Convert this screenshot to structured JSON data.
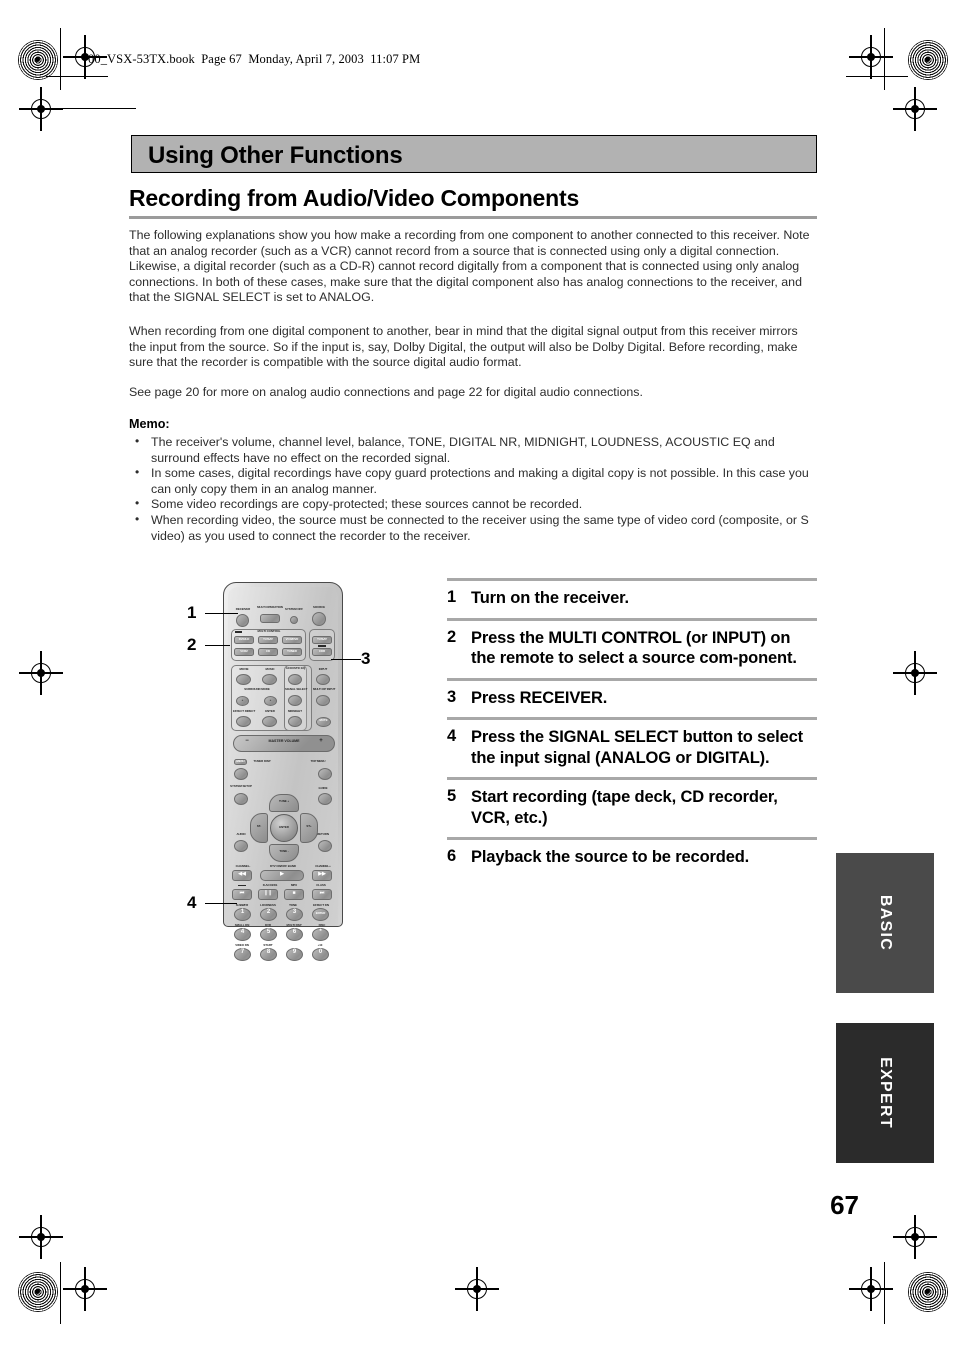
{
  "doc_header": "00_VSX-53TX.book  Page 67  Monday, April 7, 2003  11:07 PM",
  "section_bar_title": "Using Other Functions",
  "heading": "Recording from Audio/Video Components",
  "paragraphs": [
    "The following explanations show you how make a recording from one component to another connected to this receiver. Note that an analog recorder (such as a VCR) cannot record from a source that is connected using only a digital connection. Likewise, a digital recorder (such as a CD-R) cannot record digitally from a component that is connected using only analog connections. In both of these cases, make sure that the digital component also has analog connections to the receiver, and that the SIGNAL SELECT is set to ANALOG.",
    "When recording from one digital component to another, bear in mind that the digital signal output from this receiver mirrors the input from the source. So if the input is, say, Dolby Digital, the output will also be Dolby Digital. Before recording, make sure that the recorder is compatible with the source digital audio format.",
    "See page 20 for more on analog audio connections and page 22 for digital audio connections."
  ],
  "memo": {
    "label": "Memo:",
    "items": [
      "The receiver's volume, channel level, balance, TONE, DIGITAL NR, MIDNIGHT, LOUDNESS, ACOUSTIC EQ and surround effects have no effect on the recorded signal.",
      "In some cases, digital recordings have copy guard protections and making a digital copy is not possible. In this case you can only copy them in an analog manner.",
      "Some video recordings are copy-protected; these sources cannot be recorded.",
      "When recording video, the source must be connected to the receiver using the same type of video cord (composite, or S video) as you used to connect the recorder to the receiver."
    ]
  },
  "steps": [
    {
      "num": "1",
      "text": "Turn on the receiver."
    },
    {
      "num": "2",
      "text": "Press the MULTI CONTROL (or INPUT) on the remote to select a source com-ponent."
    },
    {
      "num": "3",
      "text": "Press RECEIVER."
    },
    {
      "num": "4",
      "text": "Press the SIGNAL SELECT button to select the input signal (ANALOG or DIGITAL)."
    },
    {
      "num": "5",
      "text": "Start recording (tape deck, CD recorder, VCR, etc.)"
    },
    {
      "num": "6",
      "text": "Playback the source to be recorded."
    }
  ],
  "remote": {
    "callouts": [
      {
        "id": "1",
        "target": "RECEIVER button"
      },
      {
        "id": "2",
        "target": "MULTI CONTROL buttons"
      },
      {
        "id": "3",
        "target": "RECEIVER / source button"
      },
      {
        "id": "4",
        "target": "SIGNAL SELECT number button 4"
      }
    ],
    "labels": {
      "receiver": "RECEIVER",
      "multi_operation": "MULTI OPERATION",
      "system_off": "SYSTEM OFF",
      "source": "SOURCE",
      "multi_control": "MULTI CONTROL",
      "dvd_ld": "DVD/LD",
      "tv_sat": "TV/SAT",
      "vcr_dvr": "VCR/DVR",
      "vcr2": "VCR2",
      "cd": "CD",
      "tuner": "TUNER",
      "tv_sat2": "TV/SAT",
      "cdr": "CDR",
      "movie": "MOVIE",
      "music": "MUSIC",
      "acoustic_eq": "ACOUSTIC EQ",
      "input": "INPUT",
      "surround_mode": "SURROUND MODE",
      "signal_select": "SIGNAL SELECT",
      "multi_op_input": "MULTI OP INPUT",
      "effect_direct": "EFFECT DIRECT",
      "enter": "ENTER",
      "midnight": "MIDNIGHT",
      "mute": "MUTE",
      "master_volume": "MASTER VOLUME",
      "menu": "MENU",
      "tuner_disp": "TUNER DISP",
      "top_menu": "TOP MENU",
      "system_setup": "SYSTEM SETUP",
      "guide": "GUIDE",
      "tune_plus": "TUNE +",
      "tune_minus": "TUNE -",
      "st_minus": "ST-",
      "st_plus": "ST+",
      "audio": "AUDIO",
      "return": "RETURN",
      "channel_minus": "CHANNEL-",
      "channel_plus": "CHANNEL+",
      "dtv_on_off_band": "DTV ON/OFF BAND",
      "d_access": "D.ACCESS",
      "mpx": "MPX",
      "class": "CLASS",
      "num1": "1",
      "num2": "2",
      "num3": "3",
      "num4": "4",
      "num5": "5",
      "num6": "6",
      "num7": "7",
      "num8": "8",
      "num9": "9",
      "num0": "0",
      "k_subwfr": "SUBWFR",
      "k_loudness": "LOUDNESS",
      "k_tone": "TONE",
      "k_effect_dn": "EFFECT DN",
      "k_small_dn": "SMALL DN",
      "k_dvr": "DVR",
      "k_multi_dsp": "MULTI DSP",
      "k_disc": "DISC",
      "k_video_dn": "VIDEO DN",
      "k_start": "START",
      "k_enter": "ENTER",
      "k_star": "*",
      "k_plus10": "+10"
    }
  },
  "side_tabs": [
    {
      "label": "BASIC",
      "color": "#4a4a4a"
    },
    {
      "label": "EXPERT",
      "color": "#2b2b2b"
    }
  ],
  "page_number": "67"
}
